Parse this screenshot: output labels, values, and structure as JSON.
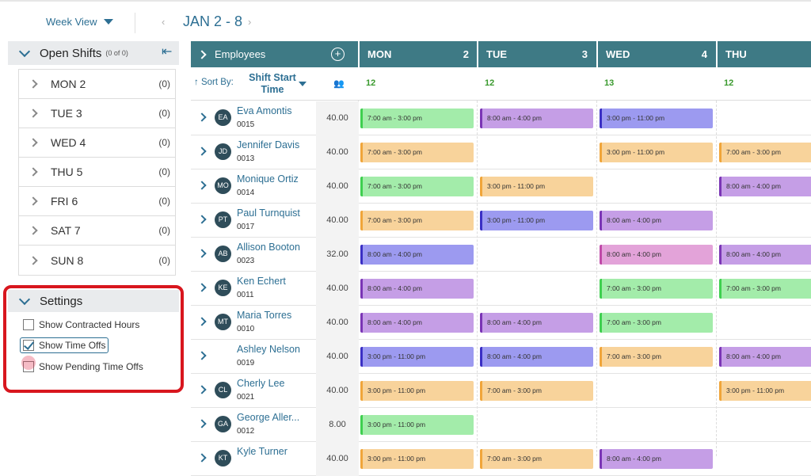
{
  "toolbar": {
    "view_label": "Week View",
    "date_range": "JAN 2 - 8",
    "prev": "‹",
    "next": "›"
  },
  "open_shifts": {
    "title": "Open Shifts",
    "count": "(0 of 0)",
    "days": [
      {
        "label": "MON 2",
        "count": "(0)"
      },
      {
        "label": "TUE 3",
        "count": "(0)"
      },
      {
        "label": "WED 4",
        "count": "(0)"
      },
      {
        "label": "THU 5",
        "count": "(0)"
      },
      {
        "label": "FRI 6",
        "count": "(0)"
      },
      {
        "label": "SAT 7",
        "count": "(0)"
      },
      {
        "label": "SUN 8",
        "count": "(0)"
      }
    ]
  },
  "settings": {
    "title": "Settings",
    "options": [
      {
        "label": "Show Contracted Hours",
        "checked": false
      },
      {
        "label": "Show Time Offs",
        "checked": true
      },
      {
        "label": "Show Pending Time Offs",
        "checked": false
      }
    ]
  },
  "grid": {
    "employees_label": "Employees",
    "sort_by_label": "↑ Sort By:",
    "sort_field": "Shift Start Time",
    "days": [
      {
        "name": "MON",
        "date": "2",
        "count": "12"
      },
      {
        "name": "TUE",
        "date": "3",
        "count": "12"
      },
      {
        "name": "WED",
        "date": "4",
        "count": "13"
      },
      {
        "name": "THU",
        "date": "",
        "count": "12"
      }
    ],
    "employees": [
      {
        "initials": "EA",
        "name": "Eva Amontis",
        "id": "0015",
        "hours": "40.00",
        "shifts": [
          {
            "text": "7:00 am - 3:00 pm",
            "color": "green"
          },
          {
            "text": "8:00 am - 4:00 pm",
            "color": "purple"
          },
          {
            "text": "3:00 pm - 11:00 pm",
            "color": "blue"
          },
          null
        ]
      },
      {
        "initials": "JD",
        "name": "Jennifer Davis",
        "id": "0013",
        "hours": "40.00",
        "shifts": [
          {
            "text": "7:00 am - 3:00 pm",
            "color": "orange"
          },
          null,
          {
            "text": "3:00 pm - 11:00 pm",
            "color": "orange"
          },
          {
            "text": "7:00 am - 3:00 pm",
            "color": "orange"
          }
        ]
      },
      {
        "initials": "MO",
        "name": "Monique Ortiz",
        "id": "0014",
        "hours": "40.00",
        "shifts": [
          {
            "text": "7:00 am - 3:00 pm",
            "color": "green"
          },
          {
            "text": "3:00 pm - 11:00 pm",
            "color": "orange"
          },
          null,
          {
            "text": "8:00 am - 4:00 pm",
            "color": "purple"
          }
        ]
      },
      {
        "initials": "PT",
        "name": "Paul Turnquist",
        "id": "0017",
        "hours": "40.00",
        "shifts": [
          {
            "text": "7:00 am - 3:00 pm",
            "color": "orange"
          },
          {
            "text": "3:00 pm - 11:00 pm",
            "color": "blue"
          },
          {
            "text": "8:00 am - 4:00 pm",
            "color": "purple"
          },
          null
        ]
      },
      {
        "initials": "AB",
        "name": "Allison Booton",
        "id": "0023",
        "hours": "32.00",
        "shifts": [
          {
            "text": "8:00 am - 4:00 pm",
            "color": "blue"
          },
          null,
          {
            "text": "8:00 am - 4:00 pm",
            "color": "pink"
          },
          {
            "text": "8:00 am - 4:00 pm",
            "color": "purple"
          }
        ]
      },
      {
        "initials": "KE",
        "name": "Ken Echert",
        "id": "0011",
        "hours": "40.00",
        "shifts": [
          {
            "text": "8:00 am - 4:00 pm",
            "color": "purple"
          },
          null,
          {
            "text": "7:00 am - 3:00 pm",
            "color": "green"
          },
          {
            "text": "7:00 am - 3:00 pm",
            "color": "green"
          }
        ]
      },
      {
        "initials": "MT",
        "name": "Maria Torres",
        "id": "0010",
        "hours": "40.00",
        "shifts": [
          {
            "text": "8:00 am - 4:00 pm",
            "color": "purple"
          },
          {
            "text": "8:00 am - 4:00 pm",
            "color": "purple"
          },
          {
            "text": "7:00 am - 3:00 pm",
            "color": "green"
          },
          null
        ]
      },
      {
        "initials": "",
        "name": "Ashley Nelson",
        "id": "0019",
        "hours": "40.00",
        "photo": true,
        "shifts": [
          {
            "text": "3:00 pm - 11:00 pm",
            "color": "blue"
          },
          {
            "text": "8:00 am - 4:00 pm",
            "color": "blue"
          },
          {
            "text": "7:00 am - 3:00 pm",
            "color": "orange"
          },
          {
            "text": "8:00 am - 4:00 pm",
            "color": "purple"
          }
        ]
      },
      {
        "initials": "CL",
        "name": "Cherly Lee",
        "id": "0021",
        "hours": "40.00",
        "shifts": [
          {
            "text": "3:00 pm - 11:00 pm",
            "color": "orange"
          },
          {
            "text": "7:00 am - 3:00 pm",
            "color": "orange"
          },
          null,
          {
            "text": "3:00 pm - 11:00 pm",
            "color": "orange"
          }
        ]
      },
      {
        "initials": "GA",
        "name": "George Aller...",
        "id": "0012",
        "hours": "8.00",
        "shifts": [
          {
            "text": "3:00 pm - 11:00 pm",
            "color": "green"
          },
          null,
          null,
          null
        ]
      },
      {
        "initials": "KT",
        "name": "Kyle Turner",
        "id": "",
        "hours": "40.00",
        "shifts": [
          {
            "text": "3:00 pm - 11:00 pm",
            "color": "orange"
          },
          {
            "text": "7:00 am - 3:00 pm",
            "color": "orange"
          },
          {
            "text": "8:00 am - 4:00 pm",
            "color": "purple"
          },
          null
        ]
      }
    ]
  },
  "colors": {
    "green": {
      "bg": "#a3ecaa",
      "bar": "#3ecf4f"
    },
    "orange": {
      "bg": "#f8d39b",
      "bar": "#f0a53a"
    },
    "purple": {
      "bg": "#c59ee6",
      "bar": "#7a35b5"
    },
    "blue": {
      "bg": "#9c9af0",
      "bar": "#3a2fc4"
    },
    "pink": {
      "bg": "#e3a3d9",
      "bar": "#c04aa8"
    },
    "header": "#3e7a85",
    "accent": "#2d6f93",
    "highlight_border": "#d8161e"
  }
}
